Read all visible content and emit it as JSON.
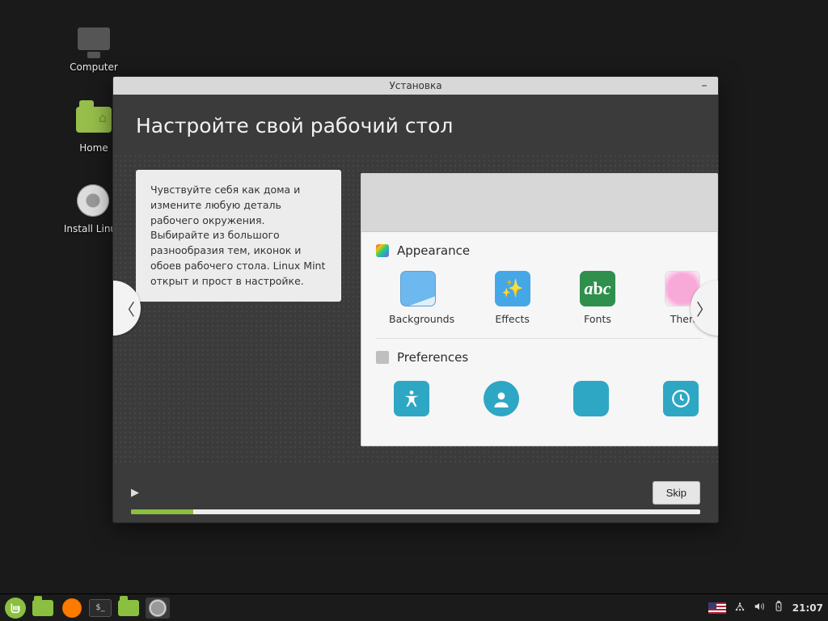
{
  "desktop": {
    "icons": [
      {
        "label": "Computer"
      },
      {
        "label": "Home"
      },
      {
        "label": "Install Linux"
      }
    ]
  },
  "window": {
    "title": "Установка",
    "heading": "Настройте свой рабочий стол",
    "blurb": "Чувствуйте себя как дома и измените любую деталь рабочего окружения. Выбирайте из большого разнообразия тем, иконок и обоев рабочего стола. Linux Mint открыт и прост в настройке.",
    "section_appearance": "Appearance",
    "section_preferences": "Preferences",
    "tiles": {
      "backgrounds": "Backgrounds",
      "effects": "Effects",
      "fonts": "Fonts",
      "themes": "Then"
    },
    "skip_label": "Skip",
    "progress_percent": 11
  },
  "taskbar": {
    "clock": "21:07"
  }
}
